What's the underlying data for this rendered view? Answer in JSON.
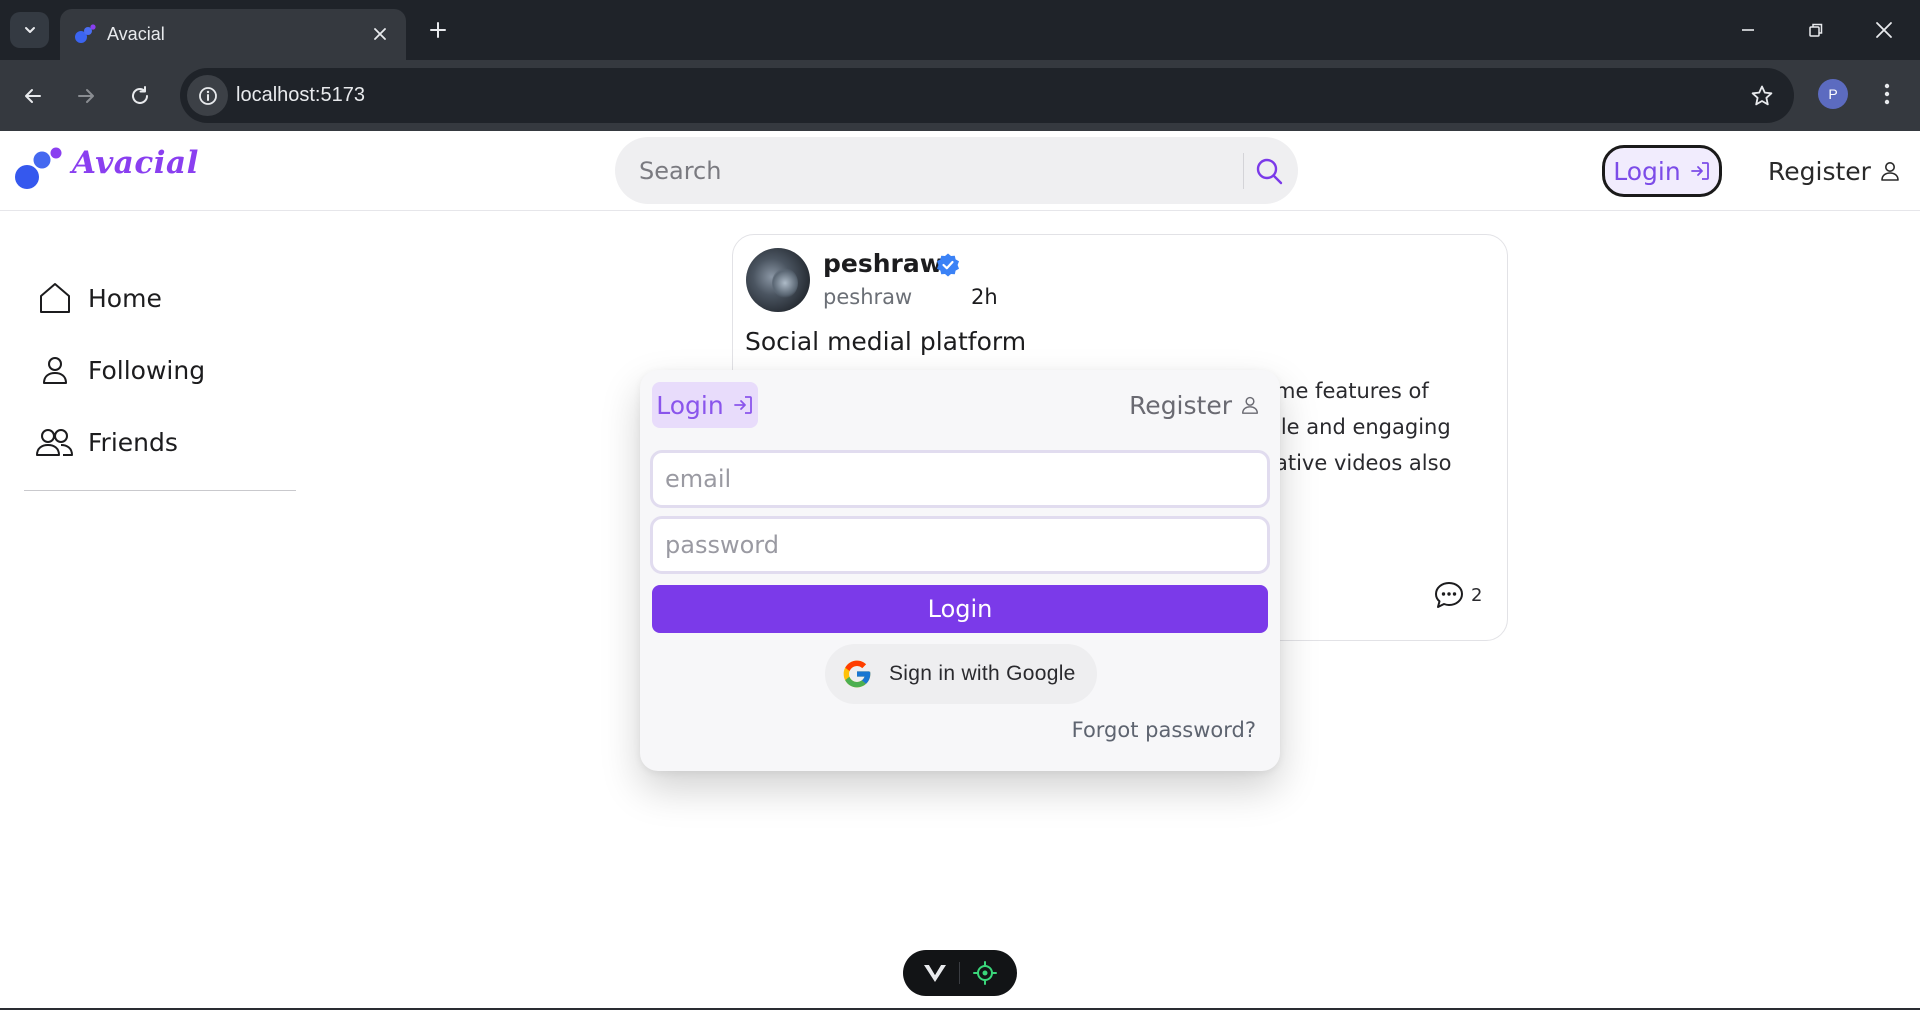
{
  "browser": {
    "tab_title": "Avacial",
    "url": "localhost:5173",
    "profile_initial": "P"
  },
  "header": {
    "logo_text": "Avacial",
    "search_placeholder": "Search",
    "login_label": "Login",
    "register_label": "Register"
  },
  "sidebar": {
    "items": [
      {
        "label": "Home",
        "icon": "home-icon"
      },
      {
        "label": "Following",
        "icon": "user-icon"
      },
      {
        "label": "Friends",
        "icon": "users-icon"
      }
    ]
  },
  "post": {
    "author_name": "peshraw",
    "author_handle": "peshraw",
    "time": "2h",
    "title": "Social medial platform",
    "body_lines": [
      "me features of",
      "ile and engaging",
      "ative videos also"
    ],
    "comment_count": "2"
  },
  "login_modal": {
    "tab_login": "Login",
    "tab_register": "Register",
    "email_placeholder": "email",
    "password_placeholder": "password",
    "submit_label": "Login",
    "google_label": "Sign in with Google",
    "forgot_label": "Forgot password?"
  },
  "colors": {
    "brand": "#7b3ae9",
    "brand_light": "#e8dcfb",
    "verified": "#3b82f6"
  }
}
